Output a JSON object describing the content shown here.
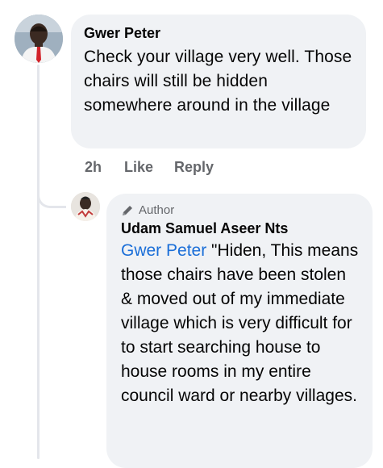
{
  "comment": {
    "author": "Gwer Peter",
    "text": "Check your village very well. Those chairs will still be hidden somewhere around in the village",
    "time": "2h",
    "like_label": "Like",
    "reply_label": "Reply"
  },
  "reply": {
    "badge": "Author",
    "author": "Udam Samuel Aseer Nts",
    "mention": "Gwer Peter",
    "text": " \"Hiden, This means those chairs have been stolen & moved out of my immediate village which is very difficult for to start searching house to house rooms in my entire council ward or nearby villages."
  },
  "colors": {
    "bubble": "#f0f2f5",
    "mention": "#1a6ed8",
    "meta": "#65676b"
  }
}
